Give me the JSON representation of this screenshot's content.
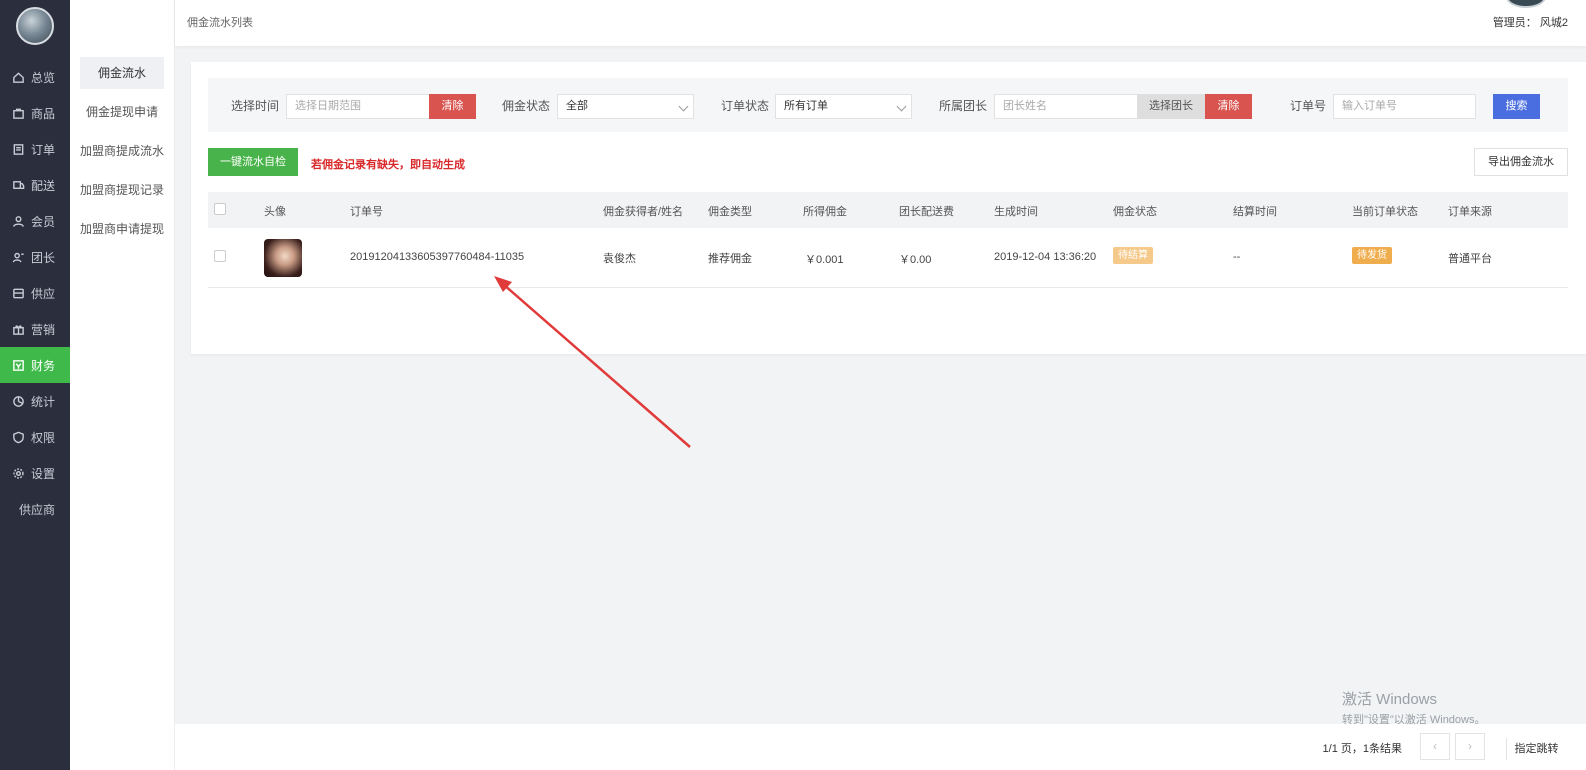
{
  "nav": {
    "items": [
      {
        "label": "总览",
        "icon": "home-icon"
      },
      {
        "label": "商品",
        "icon": "bag-icon"
      },
      {
        "label": "订单",
        "icon": "order-icon"
      },
      {
        "label": "配送",
        "icon": "delivery-icon"
      },
      {
        "label": "会员",
        "icon": "user-icon"
      },
      {
        "label": "团长",
        "icon": "leader-icon"
      },
      {
        "label": "供应",
        "icon": "supply-icon"
      },
      {
        "label": "营销",
        "icon": "gift-icon"
      },
      {
        "label": "财务",
        "icon": "finance-icon"
      },
      {
        "label": "统计",
        "icon": "pie-icon"
      },
      {
        "label": "权限",
        "icon": "shield-icon"
      },
      {
        "label": "设置",
        "icon": "gear-icon"
      },
      {
        "label": "供应商",
        "icon": ""
      }
    ]
  },
  "subnav": {
    "items": [
      "佣金流水",
      "佣金提现申请",
      "加盟商提成流水",
      "加盟商提现记录",
      "加盟商申请提现"
    ]
  },
  "header": {
    "breadcrumb": "佣金流水列表",
    "admin": "管理员：  风城2"
  },
  "filters": {
    "time_label": "选择时间",
    "time_placeholder": "选择日期范围",
    "clear1": "清除",
    "commission_status_label": "佣金状态",
    "commission_status_value": "全部",
    "order_status_label": "订单状态",
    "order_status_value": "所有订单",
    "leader_label": "所属团长",
    "leader_placeholder": "团长姓名",
    "select_leader": "选择团长",
    "clear2": "清除",
    "order_no_label": "订单号",
    "order_no_placeholder": "输入订单号",
    "search": "搜索"
  },
  "actions": {
    "check_button": "一键流水自检",
    "warning": "若佣金记录有缺失，即自动生成",
    "export_button": "导出佣金流水"
  },
  "table": {
    "headers": [
      "头像",
      "订单号",
      "佣金获得者/姓名",
      "佣金类型",
      "所得佣金",
      "团长配送费",
      "生成时间",
      "佣金状态",
      "结算时间",
      "当前订单状态",
      "订单来源"
    ],
    "rows": [
      {
        "order_no": "20191204133605397760484-11035",
        "name": "袁俊杰",
        "type": "推荐佣金",
        "commission": "￥0.001",
        "delivery_fee": "￥0.00",
        "created": "2019-12-04 13:36:20",
        "status": "待结算",
        "settle_time": "--",
        "order_status": "待发货",
        "source": "普通平台"
      }
    ]
  },
  "pager": {
    "info": "1/1 页，1条结果",
    "prev": "‹",
    "next": "›",
    "jump": "指定跳转"
  },
  "watermark": {
    "line1": "激活 Windows",
    "line2": "转到\"设置\"以激活 Windows。"
  }
}
